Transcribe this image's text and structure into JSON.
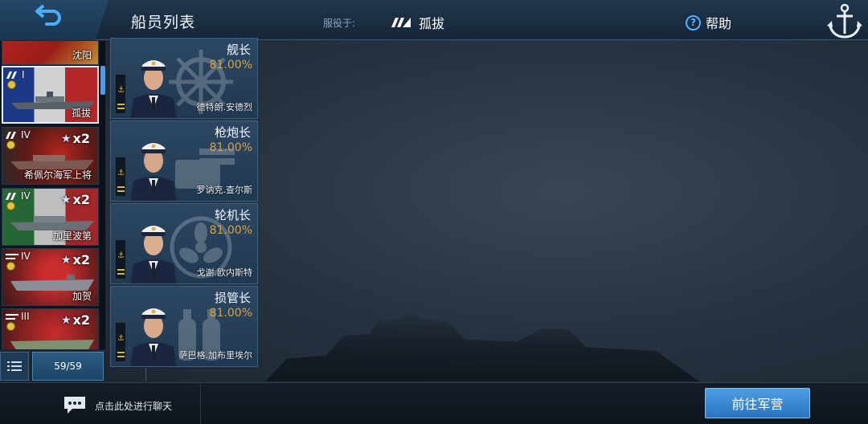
{
  "header": {
    "title": "船员列表",
    "service_label": "服役于:",
    "service_ship": "孤拔",
    "help_label": "帮助"
  },
  "ship_list": [
    {
      "name": "沈阳",
      "tier": "",
      "multiplier": "",
      "flag_colors": [
        "#b8261f",
        "#d9a93a"
      ]
    },
    {
      "name": "孤拔",
      "tier": "I",
      "multiplier": "",
      "selected": true,
      "flag_colors": [
        "#1f3f9a",
        "#f2f2f2",
        "#d22a2a"
      ]
    },
    {
      "name": "希佩尔海军上将",
      "tier": "IV",
      "multiplier": "x2",
      "flag_colors": [
        "#2a2a2a",
        "#b8261f"
      ]
    },
    {
      "name": "加里波第",
      "tier": "IV",
      "multiplier": "x2",
      "flag_colors": [
        "#2d7a3a",
        "#f2f2f2",
        "#c92a2a"
      ]
    },
    {
      "name": "加贺",
      "tier": "IV",
      "multiplier": "x2",
      "flag_colors": [
        "#c82c2c",
        "#f2ece0"
      ]
    },
    {
      "name": "",
      "tier": "III",
      "multiplier": "x2",
      "flag_colors": [
        "#c82c2c",
        "#f2ece0"
      ]
    }
  ],
  "list_footer": {
    "count": "59/59"
  },
  "crew": [
    {
      "role": "舰长",
      "percent": "81.00%",
      "name": "德特朗.安德烈",
      "icon": "ship-wheel-icon"
    },
    {
      "role": "枪炮长",
      "percent": "81.00%",
      "name": "罗讷克.查尔斯",
      "icon": "gun-turret-icon"
    },
    {
      "role": "轮机长",
      "percent": "81.00%",
      "name": "戈谢.欧内斯特",
      "icon": "propeller-icon"
    },
    {
      "role": "损管长",
      "percent": "81.00%",
      "name": "萨巴格.加布里埃尔",
      "icon": "fire-extinguisher-icon"
    }
  ],
  "bottom": {
    "chat_text": "点击此处进行聊天",
    "goto_label": "前往军营"
  },
  "colors": {
    "accent_blue": "#4c9ee3",
    "percent_gold": "#d7a43e"
  }
}
